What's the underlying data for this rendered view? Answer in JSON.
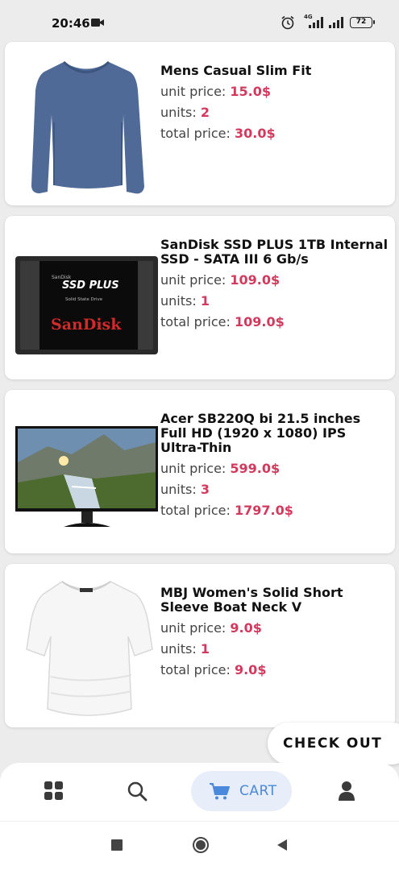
{
  "status_bar": {
    "time": "20:46",
    "network": "4G",
    "battery": "72"
  },
  "cart_items": [
    {
      "title": "Mens Casual Slim Fit",
      "unit_price_label": "unit price: ",
      "unit_price": "15.0$",
      "units_label": "units: ",
      "units": "2",
      "total_label": "total price: ",
      "total": "30.0$",
      "image": "blue-long-sleeve-shirt"
    },
    {
      "title": "SanDisk SSD PLUS 1TB Internal SSD - SATA III 6 Gb/s",
      "unit_price_label": "unit price: ",
      "unit_price": "109.0$",
      "units_label": "units: ",
      "units": "1",
      "total_label": "total price: ",
      "total": "109.0$",
      "image": "sandisk-ssd",
      "image_text": {
        "brand_small": "SanDisk",
        "model": "SSD PLUS",
        "subtitle": "Solid State Drive",
        "brand": "SanDisk"
      }
    },
    {
      "title": "Acer SB220Q bi 21.5 inches Full HD (1920 x 1080) IPS Ultra-Thin",
      "unit_price_label": "unit price: ",
      "unit_price": "599.0$",
      "units_label": "units: ",
      "units": "3",
      "total_label": "total price: ",
      "total": "1797.0$",
      "image": "acer-monitor"
    },
    {
      "title": "MBJ Women's Solid Short Sleeve Boat Neck V",
      "unit_price_label": "unit price: ",
      "unit_price": "9.0$",
      "units_label": "units: ",
      "units": "1",
      "total_label": "total price: ",
      "total": "9.0$",
      "image": "white-womens-top"
    }
  ],
  "checkout_label": "CHECK OUT",
  "bottom_nav": {
    "items": [
      {
        "icon": "grid-icon"
      },
      {
        "icon": "search-icon"
      },
      {
        "icon": "cart-icon",
        "label": "CART",
        "active": true
      },
      {
        "icon": "person-icon"
      }
    ],
    "accent": "#4a89dc"
  },
  "colors": {
    "price": "#d3395d",
    "background": "#ececec"
  }
}
